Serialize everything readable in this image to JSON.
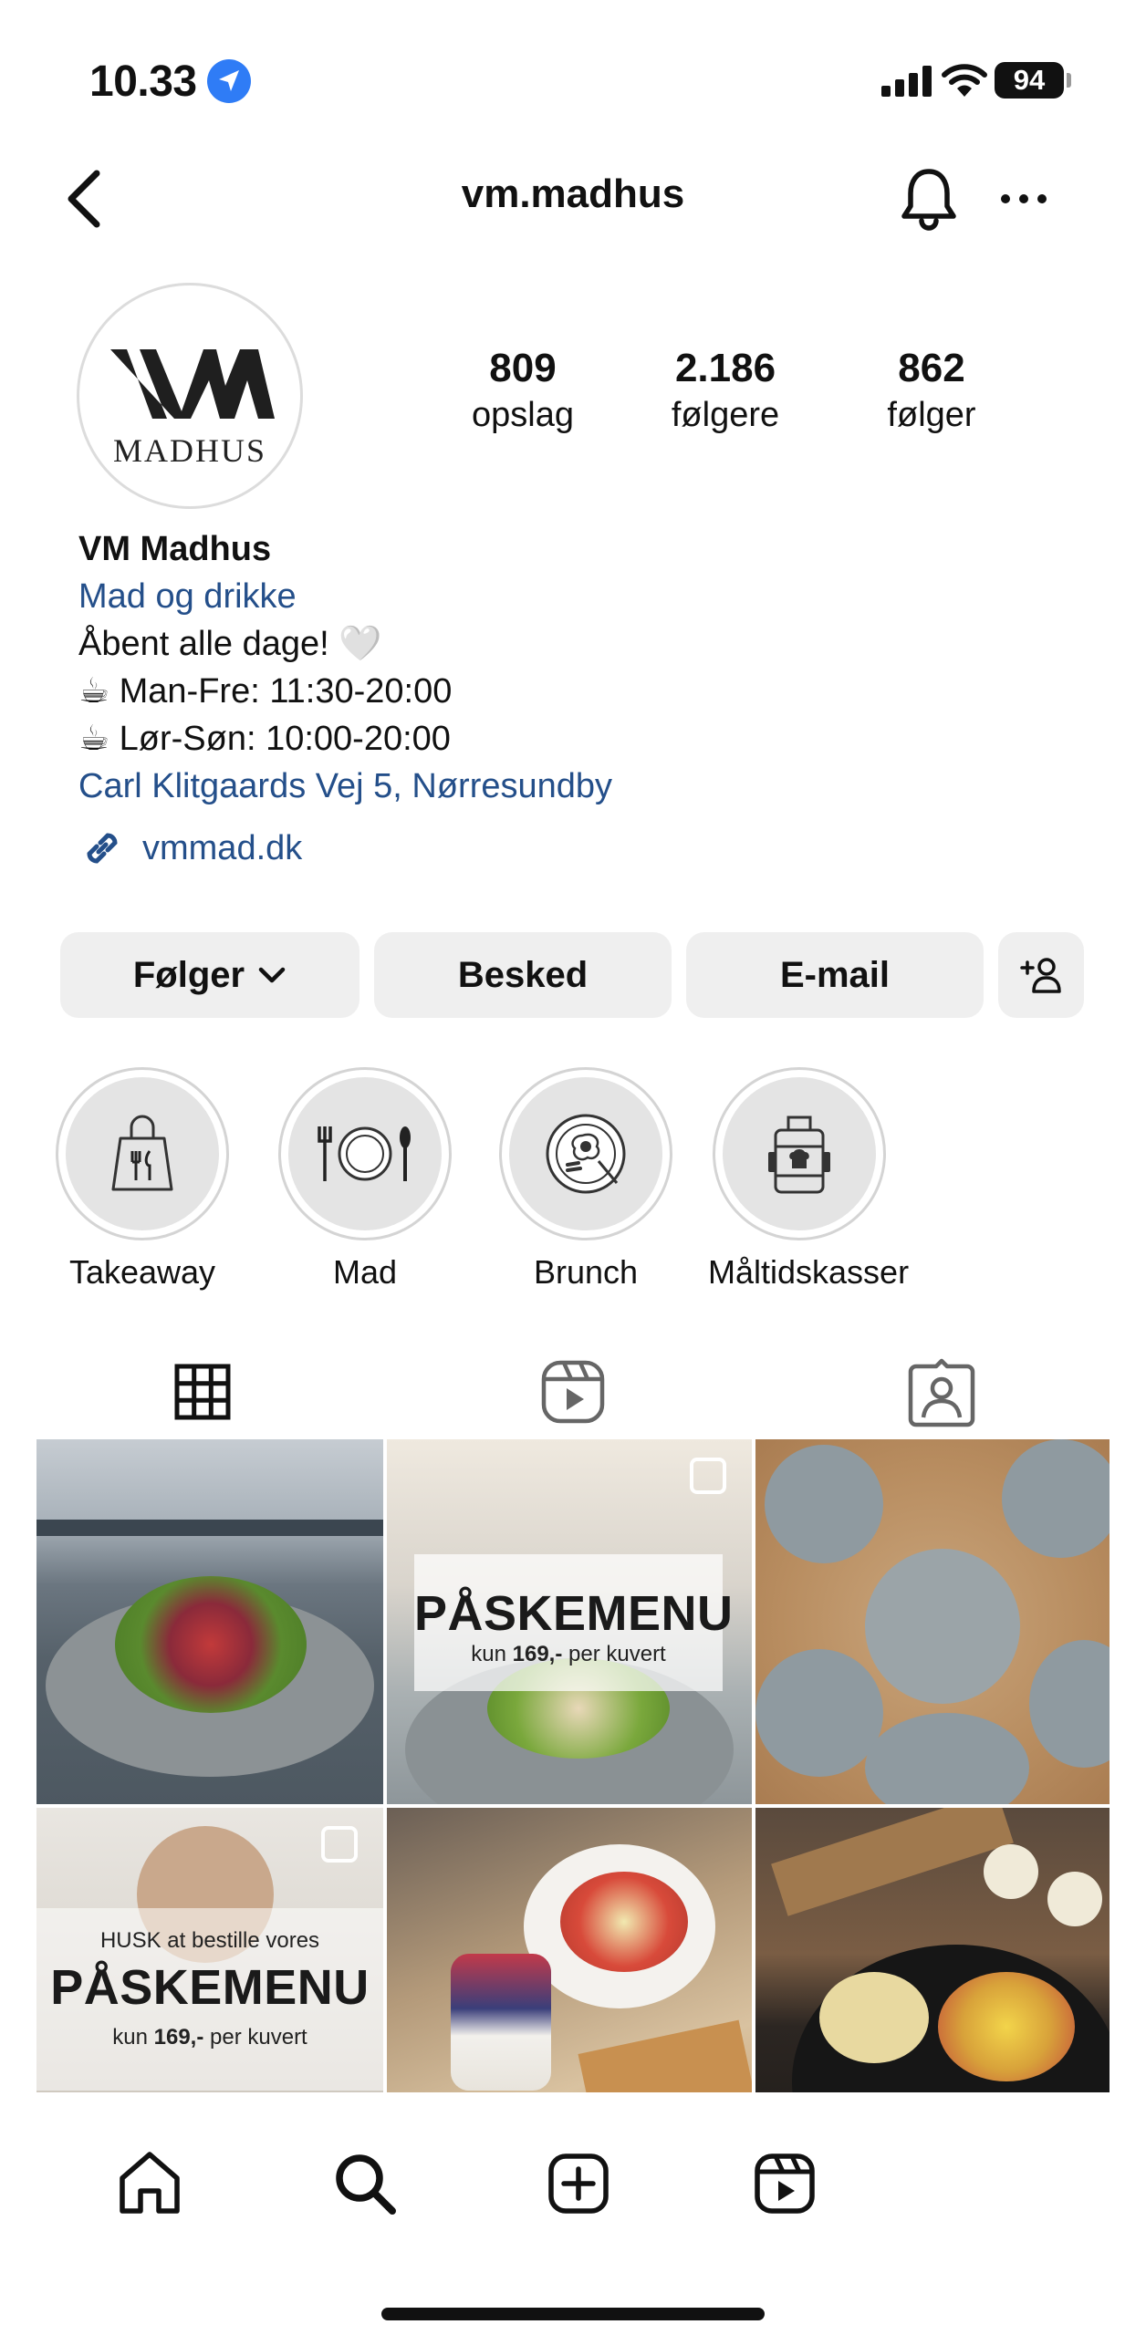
{
  "status_bar": {
    "time": "10.33",
    "battery": "94"
  },
  "header": {
    "username": "vm.madhus"
  },
  "profile": {
    "avatar_text": "MADHUS",
    "stats": [
      {
        "value": "809",
        "label": "opslag"
      },
      {
        "value": "2.186",
        "label": "følgere"
      },
      {
        "value": "862",
        "label": "følger"
      }
    ],
    "name": "VM Madhus",
    "category": "Mad og drikke",
    "bio_lines": [
      "Åbent alle dage! 🤍",
      "☕ Man-Fre: 11:30-20:00",
      "☕ Lør-Søn: 10:00-20:00"
    ],
    "address": "Carl Klitgaards Vej 5, Nørresundby",
    "website": "vmmad.dk"
  },
  "actions": {
    "follow": "Følger",
    "message": "Besked",
    "email": "E-mail"
  },
  "highlights": [
    {
      "label": "Takeaway",
      "icon": "takeaway-bag-icon"
    },
    {
      "label": "Mad",
      "icon": "plate-cutlery-icon"
    },
    {
      "label": "Brunch",
      "icon": "brunch-plate-icon"
    },
    {
      "label": "Måltidskasser",
      "icon": "meal-box-icon"
    }
  ],
  "posts": {
    "promo1": {
      "title": "PÅSKEMENU",
      "sub_pre": "kun ",
      "price": "169,-",
      "sub_post": " per kuvert"
    },
    "promo2": {
      "pre": "HUSK at bestille vores",
      "title": "PÅSKEMENU",
      "sub_pre": "kun ",
      "price": "169,-",
      "sub_post": " per kuvert"
    }
  }
}
